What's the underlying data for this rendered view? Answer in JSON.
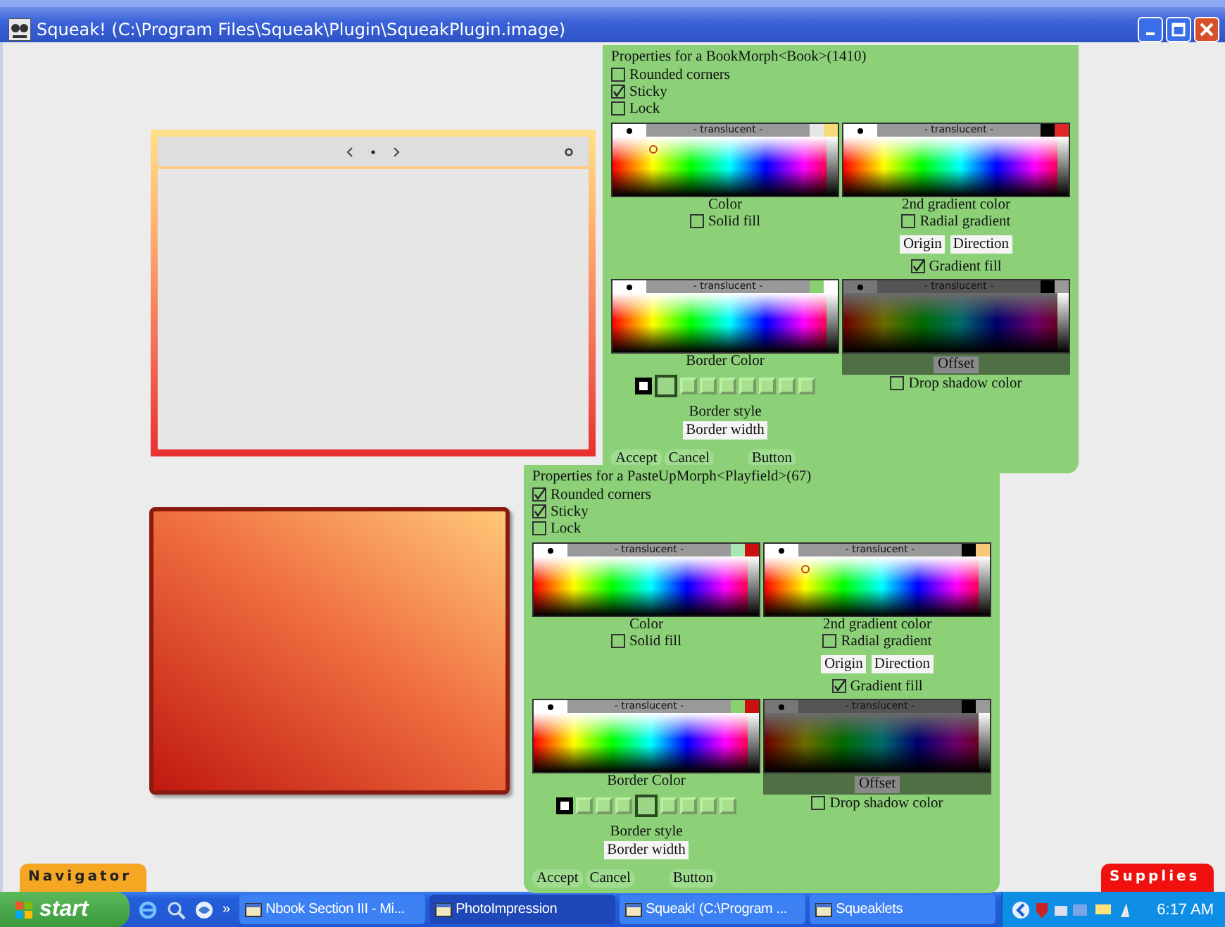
{
  "window": {
    "title": "Squeak! (C:\\Program Files\\Squeak\\Plugin\\SqueakPlugin.image)"
  },
  "panels": [
    {
      "title": "Properties for a BookMorph<Book>(1410)",
      "checkboxes": [
        {
          "label": "Rounded corners",
          "checked": false
        },
        {
          "label": "Sticky",
          "checked": true
        },
        {
          "label": "Lock",
          "checked": false
        }
      ],
      "color": {
        "picker": {
          "translucent": "- translucent -",
          "swatches": [
            {
              "color": "#e6e6e6"
            },
            {
              "color": "#f5dc78"
            }
          ],
          "marker": true
        },
        "label": "Color",
        "solid_fill": {
          "label": "Solid fill",
          "checked": false
        }
      },
      "gradient": {
        "picker": {
          "translucent": "- translucent -",
          "swatches": [
            {
              "color": "#000000"
            },
            {
              "color": "#e02828"
            }
          ],
          "marker": false
        },
        "label": "2nd gradient color",
        "radial": {
          "label": "Radial gradient",
          "checked": false
        },
        "buttons": [
          "Origin",
          "Direction"
        ],
        "gradient_fill": {
          "label": "Gradient fill",
          "checked": true
        }
      },
      "border": {
        "picker": {
          "translucent": "- translucent -",
          "swatches": [
            {
              "color": "#88d070"
            },
            {
              "color": "#ffffff"
            }
          ],
          "marker": false
        },
        "label": "Border Color",
        "styles": [
          {
            "selected": false
          },
          {
            "selected": true
          },
          {
            "selected": false
          },
          {
            "selected": false
          },
          {
            "selected": false
          },
          {
            "selected": false
          },
          {
            "selected": false
          },
          {
            "selected": false
          },
          {
            "selected": false
          }
        ],
        "style_label": "Border style",
        "width_button": "Border width"
      },
      "shadow": {
        "picker": {
          "translucent": "- translucent -",
          "swatches": [
            {
              "color": "#000000"
            },
            {
              "color": "#9a9a9a"
            }
          ],
          "marker": false
        },
        "offset_button": "Offset",
        "drop_shadow": {
          "label": "Drop shadow color",
          "checked": false
        }
      },
      "buttons": [
        "Accept",
        "Cancel",
        "Button"
      ]
    },
    {
      "title": "Properties for a PasteUpMorph<Playfield>(67)",
      "checkboxes": [
        {
          "label": "Rounded corners",
          "checked": true
        },
        {
          "label": "Sticky",
          "checked": true
        },
        {
          "label": "Lock",
          "checked": false
        }
      ],
      "color": {
        "picker": {
          "translucent": "- translucent -",
          "swatches": [
            {
              "color": "#a8e8b0"
            },
            {
              "color": "#cc1010"
            }
          ],
          "marker": false
        },
        "label": "Color",
        "solid_fill": {
          "label": "Solid fill",
          "checked": false
        }
      },
      "gradient": {
        "picker": {
          "translucent": "- translucent -",
          "swatches": [
            {
              "color": "#000000"
            },
            {
              "color": "#f8c878"
            }
          ],
          "marker": true
        },
        "label": "2nd gradient color",
        "radial": {
          "label": "Radial gradient",
          "checked": false
        },
        "buttons": [
          "Origin",
          "Direction"
        ],
        "gradient_fill": {
          "label": "Gradient fill",
          "checked": true
        }
      },
      "border": {
        "picker": {
          "translucent": "- translucent -",
          "swatches": [
            {
              "color": "#88d070"
            },
            {
              "color": "#cc1010"
            }
          ],
          "marker": false
        },
        "label": "Border Color",
        "styles": [
          {
            "selected": false
          },
          {
            "selected": false
          },
          {
            "selected": false
          },
          {
            "selected": false
          },
          {
            "selected": true
          },
          {
            "selected": false
          },
          {
            "selected": false
          },
          {
            "selected": false
          },
          {
            "selected": false
          }
        ],
        "style_label": "Border style",
        "width_button": "Border width"
      },
      "shadow": {
        "picker": {
          "translucent": "- translucent -",
          "swatches": [
            {
              "color": "#000000"
            },
            {
              "color": "#9a9a9a"
            }
          ],
          "marker": false
        },
        "offset_button": "Offset",
        "drop_shadow": {
          "label": "Drop shadow color",
          "checked": false
        }
      },
      "buttons": [
        "Accept",
        "Cancel",
        "Button"
      ]
    }
  ],
  "flaps": {
    "navigator": "Navigator",
    "supplies": "Supplies"
  },
  "taskbar": {
    "start": "start",
    "quick_launch_more": "»",
    "tasks": [
      {
        "label": "Nbook Section III - Mi...",
        "selected": false
      },
      {
        "label": "PhotoImpression",
        "selected": true
      },
      {
        "label": "Squeak! (C:\\Program ...",
        "selected": false
      },
      {
        "label": "Squeaklets",
        "selected": false
      }
    ],
    "clock": "6:17 AM"
  }
}
